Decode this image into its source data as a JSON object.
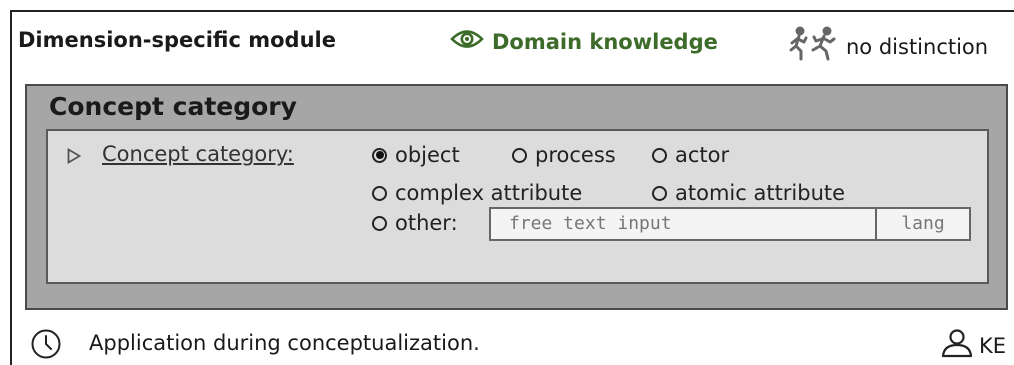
{
  "header": {
    "module_title": "Dimension-specific module",
    "domain_label": "Domain knowledge",
    "distinction_label": "no distinction",
    "domain_icon": "eye-icon",
    "distinction_icon": "running-people-icon",
    "domain_color": "#3d6b2a"
  },
  "section": {
    "title": "Concept category",
    "field_label": "Concept category:",
    "expand_icon": "triangle-right-icon",
    "options": [
      {
        "label": "object",
        "selected": true
      },
      {
        "label": "process",
        "selected": false
      },
      {
        "label": "actor",
        "selected": false
      },
      {
        "label": "complex attribute",
        "selected": false
      },
      {
        "label": "atomic attribute",
        "selected": false
      },
      {
        "label": "other:",
        "selected": false
      }
    ],
    "free_text_placeholder": "free text input",
    "lang_placeholder": "lang"
  },
  "footer": {
    "text": "Application during conceptualization.",
    "role": "KE",
    "clock_icon": "clock-icon",
    "user_icon": "user-icon"
  }
}
